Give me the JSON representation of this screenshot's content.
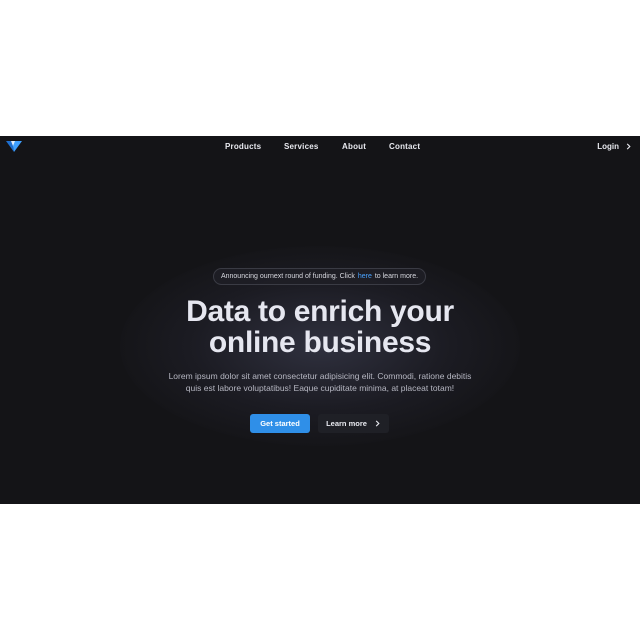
{
  "nav": {
    "items": [
      "Products",
      "Services",
      "About",
      "Contact"
    ],
    "login": "Login"
  },
  "announcement": {
    "before": "Announcing ournext round of funding. Click",
    "link": "here",
    "after": "to learn more."
  },
  "hero": {
    "line1": "Data to enrich your",
    "line2": "online business",
    "sub_line1": "Lorem ipsum dolor sit amet consectetur adipisicing elit. Commodi, ratione debitis",
    "sub_line2": "quis est labore voluptatibus! Eaque cupiditate minima, at placeat totam!"
  },
  "buttons": {
    "primary": "Get started",
    "secondary": "Learn more"
  },
  "icons": {
    "logo": "logo-icon",
    "login_chevron": "chevron-right-icon",
    "learn_chevron": "chevron-right-icon"
  },
  "colors": {
    "background": "#141417",
    "accent": "#2f8fe8",
    "link": "#4aa3ff",
    "text": "#e6e7f0"
  }
}
